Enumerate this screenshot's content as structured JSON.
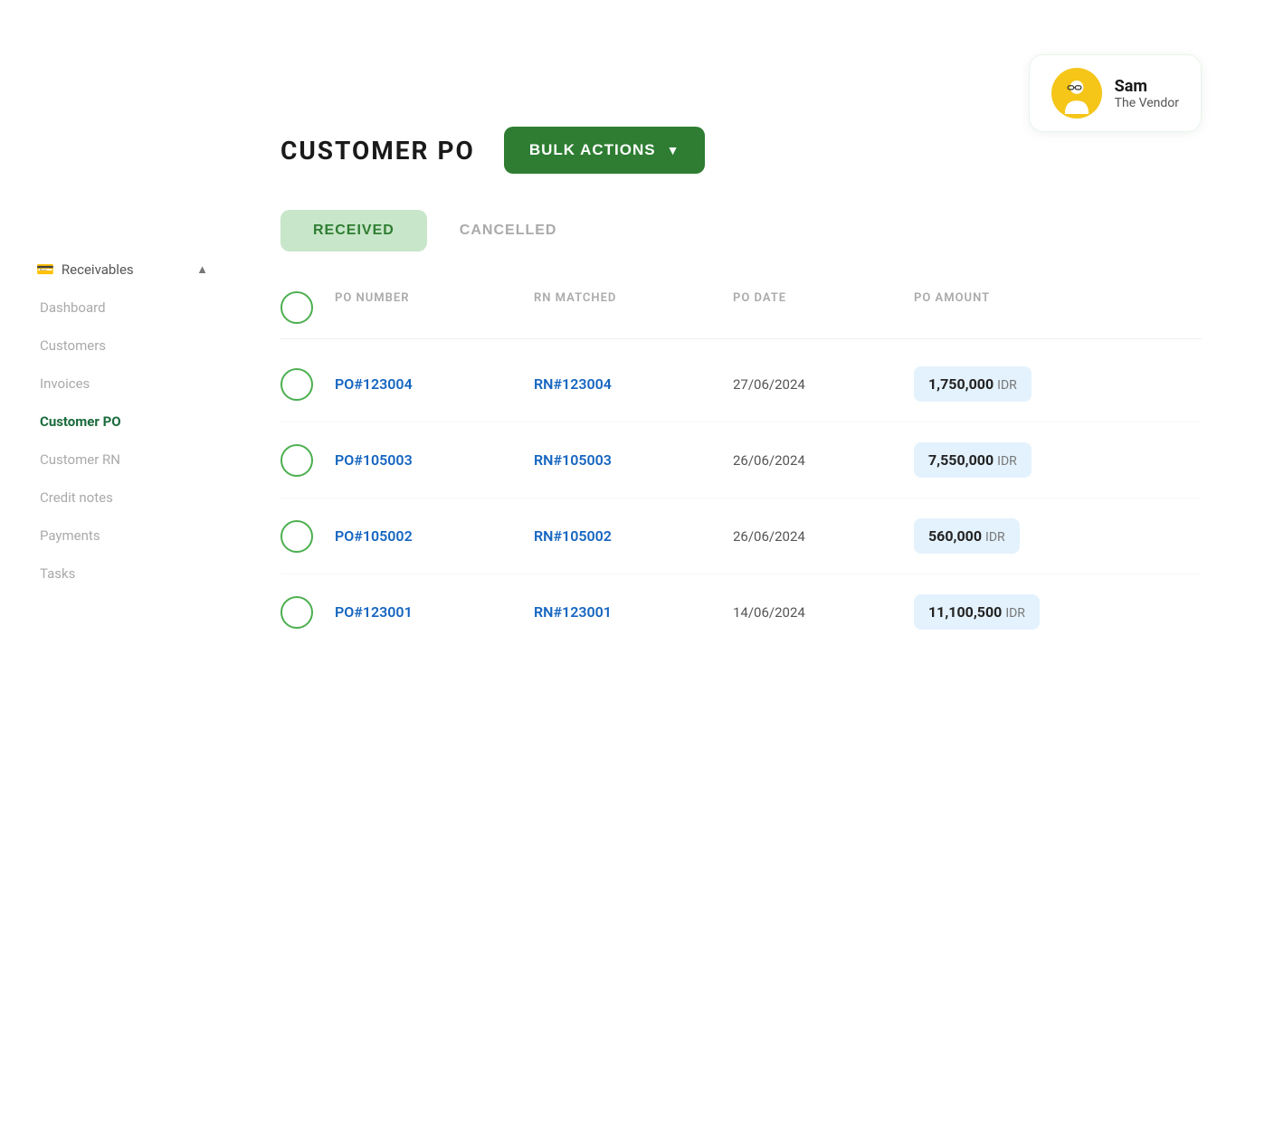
{
  "user": {
    "name": "Sam",
    "role": "The Vendor"
  },
  "sidebar": {
    "group_label": "Receivables",
    "items": [
      {
        "id": "dashboard",
        "label": "Dashboard",
        "active": false
      },
      {
        "id": "customers",
        "label": "Customers",
        "active": false
      },
      {
        "id": "invoices",
        "label": "Invoices",
        "active": false
      },
      {
        "id": "customer-po",
        "label": "Customer PO",
        "active": true
      },
      {
        "id": "customer-rn",
        "label": "Customer RN",
        "active": false
      },
      {
        "id": "credit-notes",
        "label": "Credit notes",
        "active": false
      },
      {
        "id": "payments",
        "label": "Payments",
        "active": false
      },
      {
        "id": "tasks",
        "label": "Tasks",
        "active": false
      }
    ]
  },
  "page": {
    "title": "CUSTOMER PO",
    "bulk_actions_label": "BULK ACTIONS"
  },
  "tabs": [
    {
      "id": "received",
      "label": "RECEIVED",
      "active": true
    },
    {
      "id": "cancelled",
      "label": "CANCELLED",
      "active": false
    }
  ],
  "table": {
    "columns": [
      {
        "id": "checkbox",
        "label": ""
      },
      {
        "id": "po_number",
        "label": "PO NUMBER"
      },
      {
        "id": "rn_matched",
        "label": "RN MATCHED"
      },
      {
        "id": "po_date",
        "label": "PO DATE"
      },
      {
        "id": "po_amount",
        "label": "PO AMOUNT"
      }
    ],
    "rows": [
      {
        "po_number": "PO#123004",
        "rn_matched": "RN#123004",
        "po_date": "27/06/2024",
        "po_amount": "1,750,000",
        "currency": "IDR"
      },
      {
        "po_number": "PO#105003",
        "rn_matched": "RN#105003",
        "po_date": "26/06/2024",
        "po_amount": "7,550,000",
        "currency": "IDR"
      },
      {
        "po_number": "PO#105002",
        "rn_matched": "RN#105002",
        "po_date": "26/06/2024",
        "po_amount": "560,000",
        "currency": "IDR"
      },
      {
        "po_number": "PO#123001",
        "rn_matched": "RN#123001",
        "po_date": "14/06/2024",
        "po_amount": "11,100,500",
        "currency": "IDR"
      }
    ]
  }
}
